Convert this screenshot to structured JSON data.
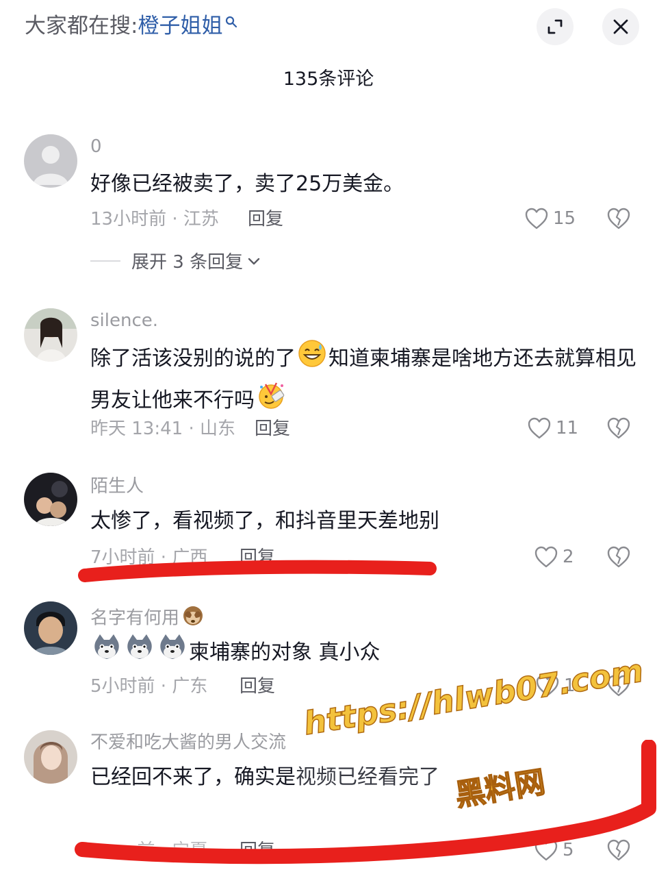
{
  "topbar": {
    "search_prefix": "大家都在搜:",
    "search_term": "橙子姐姐",
    "expand_icon": "expand-icon",
    "close_icon": "close-icon"
  },
  "comment_count": "135条评论",
  "comments": [
    {
      "username": "0",
      "text": "好像已经被卖了，卖了25万美金。",
      "meta": "13小时前 · 江苏",
      "reply": "回复",
      "likes": "15",
      "expand_replies": "展开 3 条回复"
    },
    {
      "username": "silence.",
      "text_1": "除了活该没别的说的了",
      "text_2": "知道柬埔寨是啥地方还去就算相见男友让他来不行吗",
      "meta": "昨天 13:41 · 山东",
      "reply": "回复",
      "likes": "11"
    },
    {
      "username": "陌生人",
      "text": "太惨了，看视频了，和抖音里天差地别",
      "meta": "7小时前 · 广西",
      "reply": "回复",
      "likes": "2"
    },
    {
      "username": "名字有何用",
      "text": "柬埔寨的对象 真小众",
      "meta": "5小时前 · 广东",
      "reply": "回复",
      "likes": "1"
    },
    {
      "username": "不爱和吃大酱的男人交流",
      "text": "已经回不来了，确实是",
      "text_hidden": "视频已经看完了",
      "meta": "前 · 宁夏",
      "reply": "回复",
      "likes": "5"
    }
  ],
  "watermark": {
    "url": "https://hlwb07.com",
    "name": "黑料网"
  },
  "colors": {
    "accent_blue": "#2f5ea8",
    "annotation_red": "#e8201c",
    "watermark_gold": "#f3c23c"
  }
}
